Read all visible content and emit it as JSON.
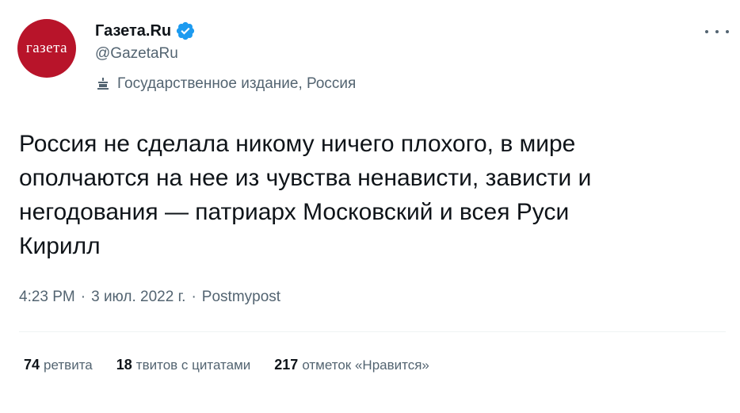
{
  "account": {
    "avatar_text": "газета",
    "display_name": "Газета.Ru",
    "handle": "@GazetaRu",
    "label": "Государственное издание, Россия",
    "verified_color": "#1d9bf0"
  },
  "tweet": {
    "text": "Россия не сделала никому ничего плохого, в мире\nополчаются на нее из чувства ненависти, зависти и\nнегодования — патриарх Московский и всея Руси\nКирилл",
    "time": "4:23 PM",
    "separator": "·",
    "date": "3 июл. 2022 г.",
    "source": "Postmypost"
  },
  "stats": {
    "retweets_count": "74",
    "retweets_label": "ретвита",
    "quotes_count": "18",
    "quotes_label": "твитов с цитатами",
    "likes_count": "217",
    "likes_label": "отметок «Нравится»"
  },
  "icons": {
    "more": "more-icon",
    "verified": "verified-badge-icon",
    "government": "government-label-icon"
  }
}
